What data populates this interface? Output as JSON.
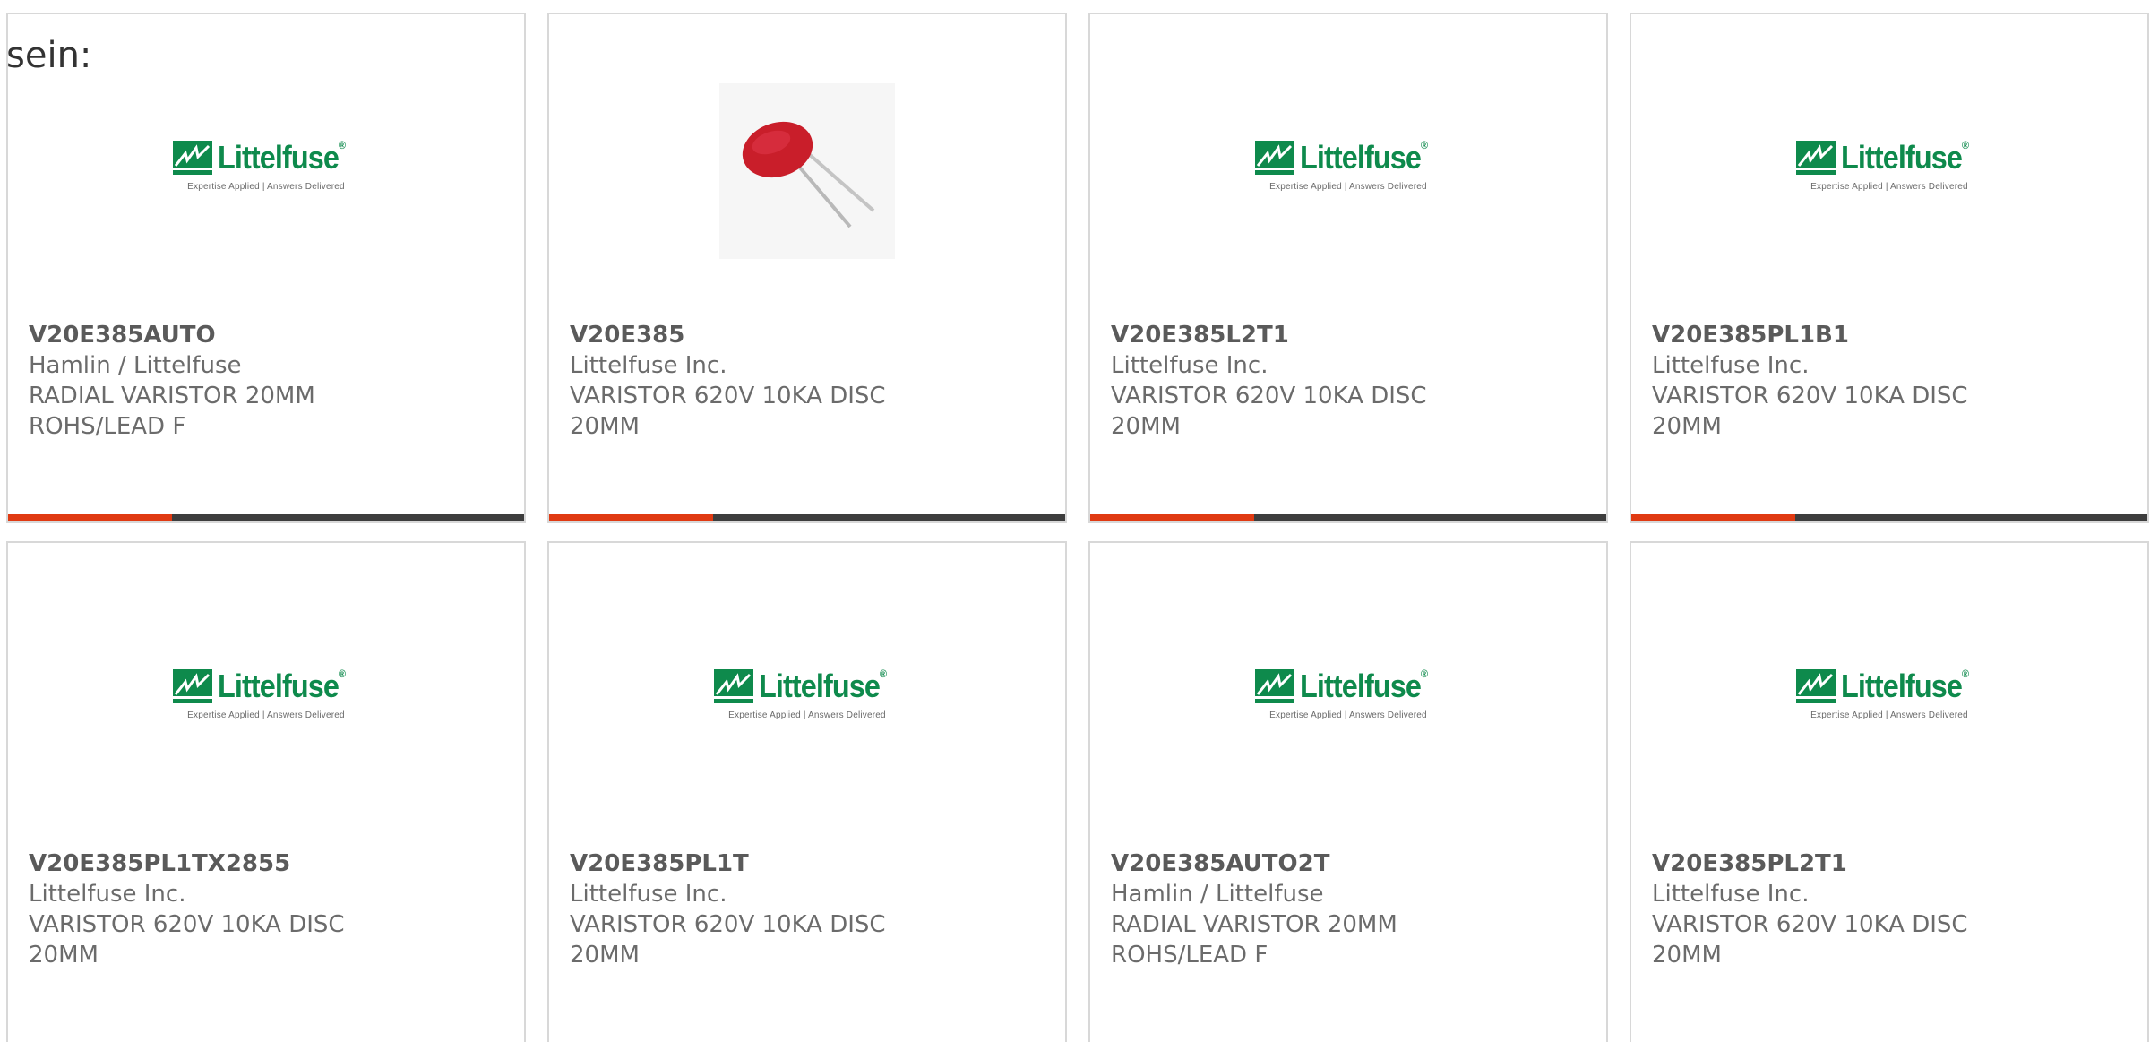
{
  "intro_text": "sein:",
  "logo": {
    "name": "Littelfuse",
    "registered": "®",
    "tagline": "Expertise Applied | Answers Delivered",
    "color": "#0e8a4c"
  },
  "accent_color": "#e03a12",
  "products": [
    {
      "part_number": "V20E385AUTO",
      "manufacturer": "Hamlin / Littelfuse",
      "description": "RADIAL VARISTOR 20MM ROHS/LEAD F",
      "image": "littelfuse-logo"
    },
    {
      "part_number": "V20E385",
      "manufacturer": "Littelfuse Inc.",
      "description": "VARISTOR 620V 10KA DISC 20MM",
      "image": "varistor-photo"
    },
    {
      "part_number": "V20E385L2T1",
      "manufacturer": "Littelfuse Inc.",
      "description": "VARISTOR 620V 10KA DISC 20MM",
      "image": "littelfuse-logo"
    },
    {
      "part_number": "V20E385PL1B1",
      "manufacturer": "Littelfuse Inc.",
      "description": "VARISTOR 620V 10KA DISC 20MM",
      "image": "littelfuse-logo"
    },
    {
      "part_number": "V20E385PL1TX2855",
      "manufacturer": "Littelfuse Inc.",
      "description": "VARISTOR 620V 10KA DISC 20MM",
      "image": "littelfuse-logo"
    },
    {
      "part_number": "V20E385PL1T",
      "manufacturer": "Littelfuse Inc.",
      "description": "VARISTOR 620V 10KA DISC 20MM",
      "image": "littelfuse-logo"
    },
    {
      "part_number": "V20E385AUTO2T",
      "manufacturer": "Hamlin / Littelfuse",
      "description": "RADIAL VARISTOR 20MM ROHS/LEAD F",
      "image": "littelfuse-logo"
    },
    {
      "part_number": "V20E385PL2T1",
      "manufacturer": "Littelfuse Inc.",
      "description": "VARISTOR 620V 10KA DISC 20MM",
      "image": "littelfuse-logo"
    }
  ]
}
